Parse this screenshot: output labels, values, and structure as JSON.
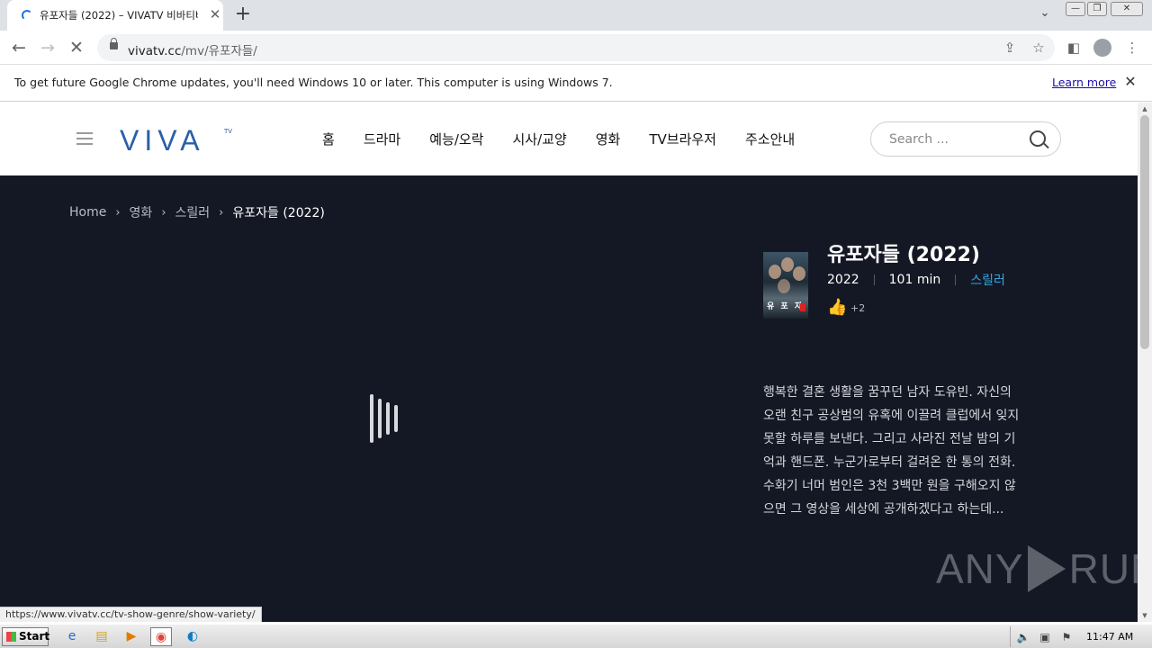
{
  "browser": {
    "tab_title": "유포자들 (2022) – VIVATV 비바티비",
    "tab_close": "✕",
    "new_tab": "+",
    "tab_search": "⌄",
    "win_minimize": "—",
    "win_restore": "❐",
    "win_close": "✕",
    "back": "←",
    "forward": "→",
    "reload": "✕",
    "url_host": "vivatv.cc",
    "url_path": "/mv/유포자들/",
    "share": "⇪",
    "bookmark": "☆",
    "side_panel": "◧",
    "menu": "⋮"
  },
  "infobar": {
    "message": "To get future Google Chrome updates, you'll need Windows 10 or later. This computer is using Windows 7.",
    "link": "Learn more",
    "close": "✕"
  },
  "site": {
    "logo": "VIVA",
    "logo_sup": "TV",
    "nav": [
      "홈",
      "드라마",
      "예능/오락",
      "시사/교양",
      "영화",
      "TV브라우저",
      "주소안내"
    ],
    "search_placeholder": "Search ..."
  },
  "breadcrumb": {
    "items": [
      "Home",
      "영화",
      "스릴러"
    ],
    "current": "유포자들 (2022)",
    "separator": "›"
  },
  "movie": {
    "title": "유포자들 (2022)",
    "poster_text": "유 포 자",
    "year": "2022",
    "runtime": "101 min",
    "genre": "스릴러",
    "like_icon": "👍",
    "likes": "+2",
    "synopsis": "행복한 결혼 생활을 꿈꾸던 남자 도유빈. 자신의 오랜 친구 공상범의 유혹에 이끌려 클럽에서 잊지 못할 하루를 보낸다. 그리고 사라진 전날 밤의 기억과 핸드폰. 누군가로부터 걸려온 한 통의 전화. 수화기 너머 범인은 3천 3백만 원을 구해오지 않으면 그 영상을 세상에 공개하겠다고 하는데..."
  },
  "watermark": {
    "left": "ANY",
    "right": "RUN"
  },
  "status_url": "https://www.vivatv.cc/tv-show-genre/show-variety/",
  "taskbar": {
    "start": "Start",
    "clock": "11:47 AM"
  },
  "colors": {
    "brand": "#2b5fa8",
    "accent_genre": "#35a8e0",
    "content_bg": "#141824"
  }
}
